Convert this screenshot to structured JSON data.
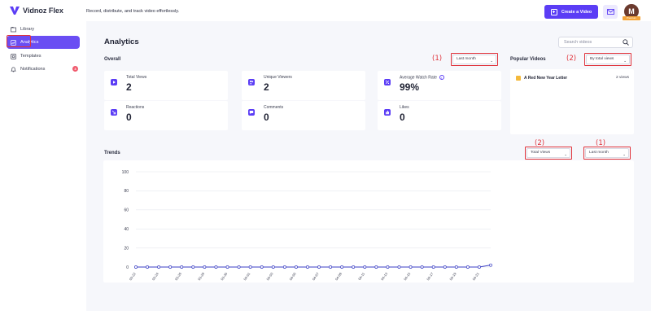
{
  "app": {
    "name": "Vidnoz Flex",
    "tagline": "Record, distribute, and track video effortlessly."
  },
  "header": {
    "create_label": "Create a Video",
    "avatar_initial": "M",
    "avatar_badge": "Premium"
  },
  "sidebar": {
    "items": [
      {
        "label": "Library",
        "icon": "library-icon"
      },
      {
        "label": "Analytics",
        "icon": "analytics-icon",
        "active": true
      },
      {
        "label": "Templates",
        "icon": "templates-icon"
      },
      {
        "label": "Notifications",
        "icon": "bell-icon",
        "badge": "3"
      }
    ]
  },
  "page": {
    "title": "Analytics",
    "search_placeholder": "Search videos"
  },
  "overall": {
    "title": "Overall",
    "period_select": "Last month",
    "annotation": "(1)",
    "stats": [
      {
        "label": "Total Views",
        "value": "2",
        "icon": "play-icon"
      },
      {
        "label": "Unique Viewers",
        "value": "2",
        "icon": "users-icon"
      },
      {
        "label": "Average Watch Rate",
        "value": "99%",
        "icon": "percent-icon"
      },
      {
        "label": "Reactions",
        "value": "0",
        "icon": "reaction-icon"
      },
      {
        "label": "Comments",
        "value": "0",
        "icon": "comment-icon"
      },
      {
        "label": "Likes",
        "value": "0",
        "icon": "thumbs-up-icon"
      }
    ]
  },
  "popular": {
    "title": "Popular Videos",
    "sort_select": "By total views",
    "annotation": "(2)",
    "items": [
      {
        "title": "A Red New Year Letter",
        "views": "2 views"
      }
    ]
  },
  "trends": {
    "title": "Trends",
    "metric_select": "Total Views",
    "period_select": "Last month",
    "annotation_metric": "(2)",
    "annotation_period": "(1)"
  },
  "colors": {
    "accent": "#5b3df5",
    "annotation": "#e0323a",
    "line": "#3b3fc4"
  },
  "chart_data": {
    "type": "line",
    "x": [
      "03-22",
      "03-24",
      "03-26",
      "03-28",
      "03-30",
      "04-01",
      "04-03",
      "04-05",
      "04-07",
      "04-09",
      "04-11",
      "04-13",
      "04-15",
      "04-17",
      "04-19",
      "04-21"
    ],
    "series": [
      {
        "values": [
          0,
          0,
          0,
          0,
          0,
          0,
          0,
          0,
          0,
          0,
          0,
          0,
          0,
          0,
          0,
          0,
          0,
          0,
          0,
          0,
          0,
          0,
          0,
          0,
          0,
          0,
          0,
          0,
          0,
          0,
          0,
          2
        ]
      }
    ],
    "y_ticks": [
      0,
      20,
      40,
      60,
      80,
      100
    ],
    "ylim": [
      0,
      100
    ],
    "grid": true
  }
}
